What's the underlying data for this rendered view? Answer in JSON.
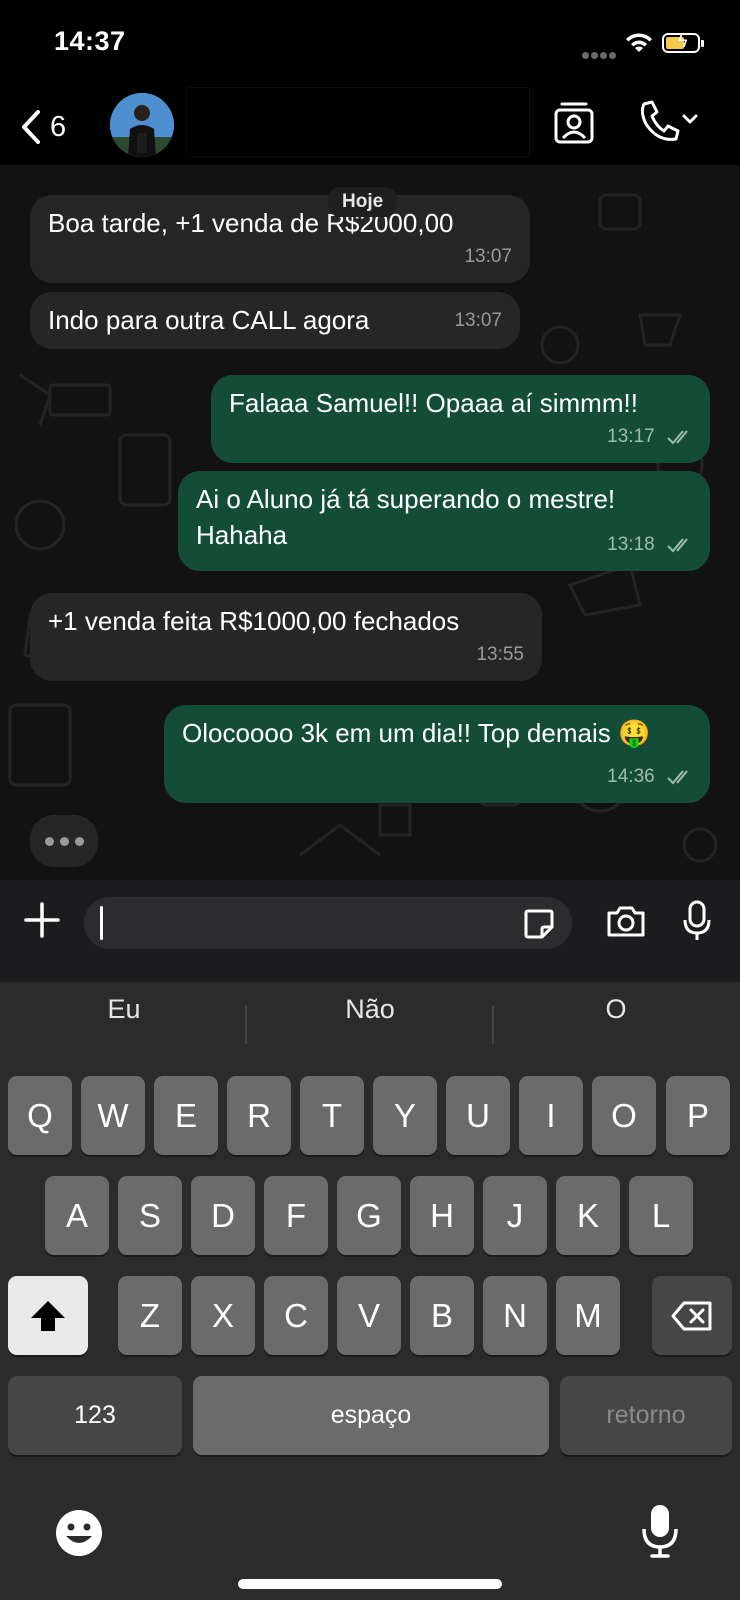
{
  "status_bar": {
    "time": "14:37"
  },
  "header": {
    "back_count": "6"
  },
  "chat": {
    "date_label": "Hoje",
    "messages": [
      {
        "direction": "in",
        "text": "Boa tarde, +1 venda de R$2000,00",
        "time": "13:07"
      },
      {
        "direction": "in",
        "text": "Indo para outra CALL agora",
        "time": "13:07"
      },
      {
        "direction": "out",
        "text": "Falaaa Samuel!! Opaaa aí simmm!!",
        "time": "13:17"
      },
      {
        "direction": "out",
        "text": "Ai o Aluno já tá superando o mestre! Hahaha",
        "time": "13:18"
      },
      {
        "direction": "in",
        "text": "+1 venda feita R$1000,00 fechados",
        "time": "13:55"
      },
      {
        "direction": "out",
        "text": "Olocoooo 3k em um dia!! Top demais 🤑",
        "time": "14:36"
      }
    ]
  },
  "input": {
    "value": "",
    "placeholder": ""
  },
  "keyboard": {
    "suggestions": [
      "Eu",
      "Não",
      "O"
    ],
    "row1": [
      "Q",
      "W",
      "E",
      "R",
      "T",
      "Y",
      "U",
      "I",
      "O",
      "P"
    ],
    "row2": [
      "A",
      "S",
      "D",
      "F",
      "G",
      "H",
      "J",
      "K",
      "L"
    ],
    "row3": [
      "Z",
      "X",
      "C",
      "V",
      "B",
      "N",
      "M"
    ],
    "numbers_key": "123",
    "space_key": "espaço",
    "return_key": "retorno"
  },
  "colors": {
    "incoming_bubble": "#262626",
    "outgoing_bubble": "#144d37",
    "chat_background": "#121212",
    "keyboard_background": "#2b2b2b"
  }
}
